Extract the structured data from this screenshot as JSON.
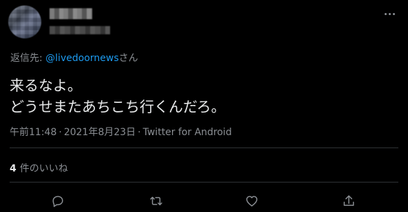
{
  "tweet": {
    "reply_prefix": "返信先: ",
    "reply_mention": "@livedoornews",
    "reply_suffix": "さん",
    "text_line1": "来るなよ。",
    "text_line2": "どうせまたあちこち行くんだろ。",
    "time": "午前11:48",
    "date": "2021年8月23日",
    "source": "Twitter for Android",
    "meta_separator": "·"
  },
  "stats": {
    "likes_count": "4",
    "likes_label": "件のいいね"
  },
  "actions": [
    {
      "icon": "reply-icon"
    },
    {
      "icon": "retweet-icon"
    },
    {
      "icon": "like-icon"
    },
    {
      "icon": "share-icon"
    }
  ],
  "colors": {
    "background": "#000000",
    "link": "#1d9bf0",
    "secondary_text": "#8b8f94",
    "primary_text": "#e7e9ea",
    "divider": "#2f3336"
  }
}
